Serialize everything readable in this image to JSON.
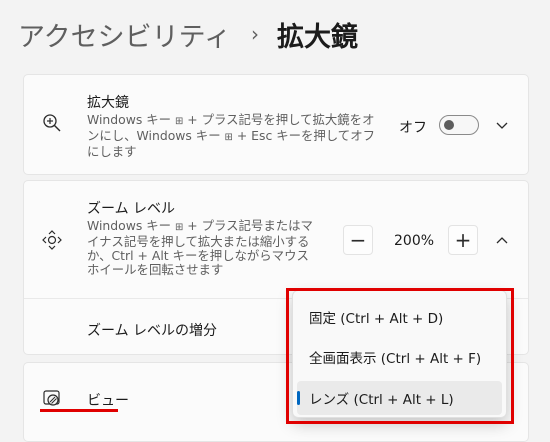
{
  "breadcrumb": {
    "parent": "アクセシビリティ",
    "separator": "›",
    "current": "拡大鏡"
  },
  "magnifier": {
    "title": "拡大鏡",
    "desc_part1": "Windows キー ",
    "desc_part2": " + プラス記号を押して拡大鏡をオンにし、Windows キー ",
    "desc_part3": " + Esc キーを押してオフにします",
    "win_key_icon": "windows-key-icon",
    "toggle_label": "オフ",
    "toggle_state": "off"
  },
  "zoom": {
    "title": "ズーム レベル",
    "desc_part1": "Windows キー ",
    "desc_part2": " + プラス記号またはマイナス記号を押して拡大または縮小するか、Ctrl + Alt キーを押しながらマウス ホイールを回転させます",
    "minus_label": "−",
    "value": "200%",
    "plus_label": "+",
    "increment_label": "ズーム レベルの増分"
  },
  "view": {
    "label": "ビュー"
  },
  "view_menu": {
    "items": [
      {
        "label": "固定 (Ctrl + Alt + D)",
        "selected": false
      },
      {
        "label": "全画面表示 (Ctrl + Alt + F)",
        "selected": false
      },
      {
        "label": "レンズ (Ctrl + Alt + L)",
        "selected": true
      }
    ]
  },
  "colors": {
    "accent": "#0067c0",
    "highlight_annotation": "#e00000",
    "background": "#f3f3f3",
    "card": "#fbfbfb"
  }
}
